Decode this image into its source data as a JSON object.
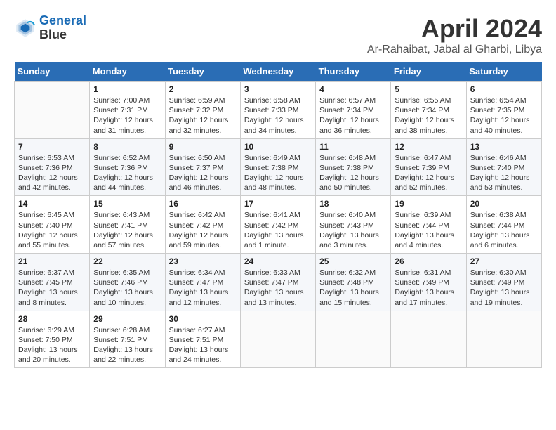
{
  "header": {
    "logo_line1": "General",
    "logo_line2": "Blue",
    "title": "April 2024",
    "subtitle": "Ar-Rahaibat, Jabal al Gharbi, Libya"
  },
  "weekdays": [
    "Sunday",
    "Monday",
    "Tuesday",
    "Wednesday",
    "Thursday",
    "Friday",
    "Saturday"
  ],
  "weeks": [
    [
      {
        "day": "",
        "sunrise": "",
        "sunset": "",
        "daylight": ""
      },
      {
        "day": "1",
        "sunrise": "Sunrise: 7:00 AM",
        "sunset": "Sunset: 7:31 PM",
        "daylight": "Daylight: 12 hours and 31 minutes."
      },
      {
        "day": "2",
        "sunrise": "Sunrise: 6:59 AM",
        "sunset": "Sunset: 7:32 PM",
        "daylight": "Daylight: 12 hours and 32 minutes."
      },
      {
        "day": "3",
        "sunrise": "Sunrise: 6:58 AM",
        "sunset": "Sunset: 7:33 PM",
        "daylight": "Daylight: 12 hours and 34 minutes."
      },
      {
        "day": "4",
        "sunrise": "Sunrise: 6:57 AM",
        "sunset": "Sunset: 7:34 PM",
        "daylight": "Daylight: 12 hours and 36 minutes."
      },
      {
        "day": "5",
        "sunrise": "Sunrise: 6:55 AM",
        "sunset": "Sunset: 7:34 PM",
        "daylight": "Daylight: 12 hours and 38 minutes."
      },
      {
        "day": "6",
        "sunrise": "Sunrise: 6:54 AM",
        "sunset": "Sunset: 7:35 PM",
        "daylight": "Daylight: 12 hours and 40 minutes."
      }
    ],
    [
      {
        "day": "7",
        "sunrise": "Sunrise: 6:53 AM",
        "sunset": "Sunset: 7:36 PM",
        "daylight": "Daylight: 12 hours and 42 minutes."
      },
      {
        "day": "8",
        "sunrise": "Sunrise: 6:52 AM",
        "sunset": "Sunset: 7:36 PM",
        "daylight": "Daylight: 12 hours and 44 minutes."
      },
      {
        "day": "9",
        "sunrise": "Sunrise: 6:50 AM",
        "sunset": "Sunset: 7:37 PM",
        "daylight": "Daylight: 12 hours and 46 minutes."
      },
      {
        "day": "10",
        "sunrise": "Sunrise: 6:49 AM",
        "sunset": "Sunset: 7:38 PM",
        "daylight": "Daylight: 12 hours and 48 minutes."
      },
      {
        "day": "11",
        "sunrise": "Sunrise: 6:48 AM",
        "sunset": "Sunset: 7:38 PM",
        "daylight": "Daylight: 12 hours and 50 minutes."
      },
      {
        "day": "12",
        "sunrise": "Sunrise: 6:47 AM",
        "sunset": "Sunset: 7:39 PM",
        "daylight": "Daylight: 12 hours and 52 minutes."
      },
      {
        "day": "13",
        "sunrise": "Sunrise: 6:46 AM",
        "sunset": "Sunset: 7:40 PM",
        "daylight": "Daylight: 12 hours and 53 minutes."
      }
    ],
    [
      {
        "day": "14",
        "sunrise": "Sunrise: 6:45 AM",
        "sunset": "Sunset: 7:40 PM",
        "daylight": "Daylight: 12 hours and 55 minutes."
      },
      {
        "day": "15",
        "sunrise": "Sunrise: 6:43 AM",
        "sunset": "Sunset: 7:41 PM",
        "daylight": "Daylight: 12 hours and 57 minutes."
      },
      {
        "day": "16",
        "sunrise": "Sunrise: 6:42 AM",
        "sunset": "Sunset: 7:42 PM",
        "daylight": "Daylight: 12 hours and 59 minutes."
      },
      {
        "day": "17",
        "sunrise": "Sunrise: 6:41 AM",
        "sunset": "Sunset: 7:42 PM",
        "daylight": "Daylight: 13 hours and 1 minute."
      },
      {
        "day": "18",
        "sunrise": "Sunrise: 6:40 AM",
        "sunset": "Sunset: 7:43 PM",
        "daylight": "Daylight: 13 hours and 3 minutes."
      },
      {
        "day": "19",
        "sunrise": "Sunrise: 6:39 AM",
        "sunset": "Sunset: 7:44 PM",
        "daylight": "Daylight: 13 hours and 4 minutes."
      },
      {
        "day": "20",
        "sunrise": "Sunrise: 6:38 AM",
        "sunset": "Sunset: 7:44 PM",
        "daylight": "Daylight: 13 hours and 6 minutes."
      }
    ],
    [
      {
        "day": "21",
        "sunrise": "Sunrise: 6:37 AM",
        "sunset": "Sunset: 7:45 PM",
        "daylight": "Daylight: 13 hours and 8 minutes."
      },
      {
        "day": "22",
        "sunrise": "Sunrise: 6:35 AM",
        "sunset": "Sunset: 7:46 PM",
        "daylight": "Daylight: 13 hours and 10 minutes."
      },
      {
        "day": "23",
        "sunrise": "Sunrise: 6:34 AM",
        "sunset": "Sunset: 7:47 PM",
        "daylight": "Daylight: 13 hours and 12 minutes."
      },
      {
        "day": "24",
        "sunrise": "Sunrise: 6:33 AM",
        "sunset": "Sunset: 7:47 PM",
        "daylight": "Daylight: 13 hours and 13 minutes."
      },
      {
        "day": "25",
        "sunrise": "Sunrise: 6:32 AM",
        "sunset": "Sunset: 7:48 PM",
        "daylight": "Daylight: 13 hours and 15 minutes."
      },
      {
        "day": "26",
        "sunrise": "Sunrise: 6:31 AM",
        "sunset": "Sunset: 7:49 PM",
        "daylight": "Daylight: 13 hours and 17 minutes."
      },
      {
        "day": "27",
        "sunrise": "Sunrise: 6:30 AM",
        "sunset": "Sunset: 7:49 PM",
        "daylight": "Daylight: 13 hours and 19 minutes."
      }
    ],
    [
      {
        "day": "28",
        "sunrise": "Sunrise: 6:29 AM",
        "sunset": "Sunset: 7:50 PM",
        "daylight": "Daylight: 13 hours and 20 minutes."
      },
      {
        "day": "29",
        "sunrise": "Sunrise: 6:28 AM",
        "sunset": "Sunset: 7:51 PM",
        "daylight": "Daylight: 13 hours and 22 minutes."
      },
      {
        "day": "30",
        "sunrise": "Sunrise: 6:27 AM",
        "sunset": "Sunset: 7:51 PM",
        "daylight": "Daylight: 13 hours and 24 minutes."
      },
      {
        "day": "",
        "sunrise": "",
        "sunset": "",
        "daylight": ""
      },
      {
        "day": "",
        "sunrise": "",
        "sunset": "",
        "daylight": ""
      },
      {
        "day": "",
        "sunrise": "",
        "sunset": "",
        "daylight": ""
      },
      {
        "day": "",
        "sunrise": "",
        "sunset": "",
        "daylight": ""
      }
    ]
  ]
}
